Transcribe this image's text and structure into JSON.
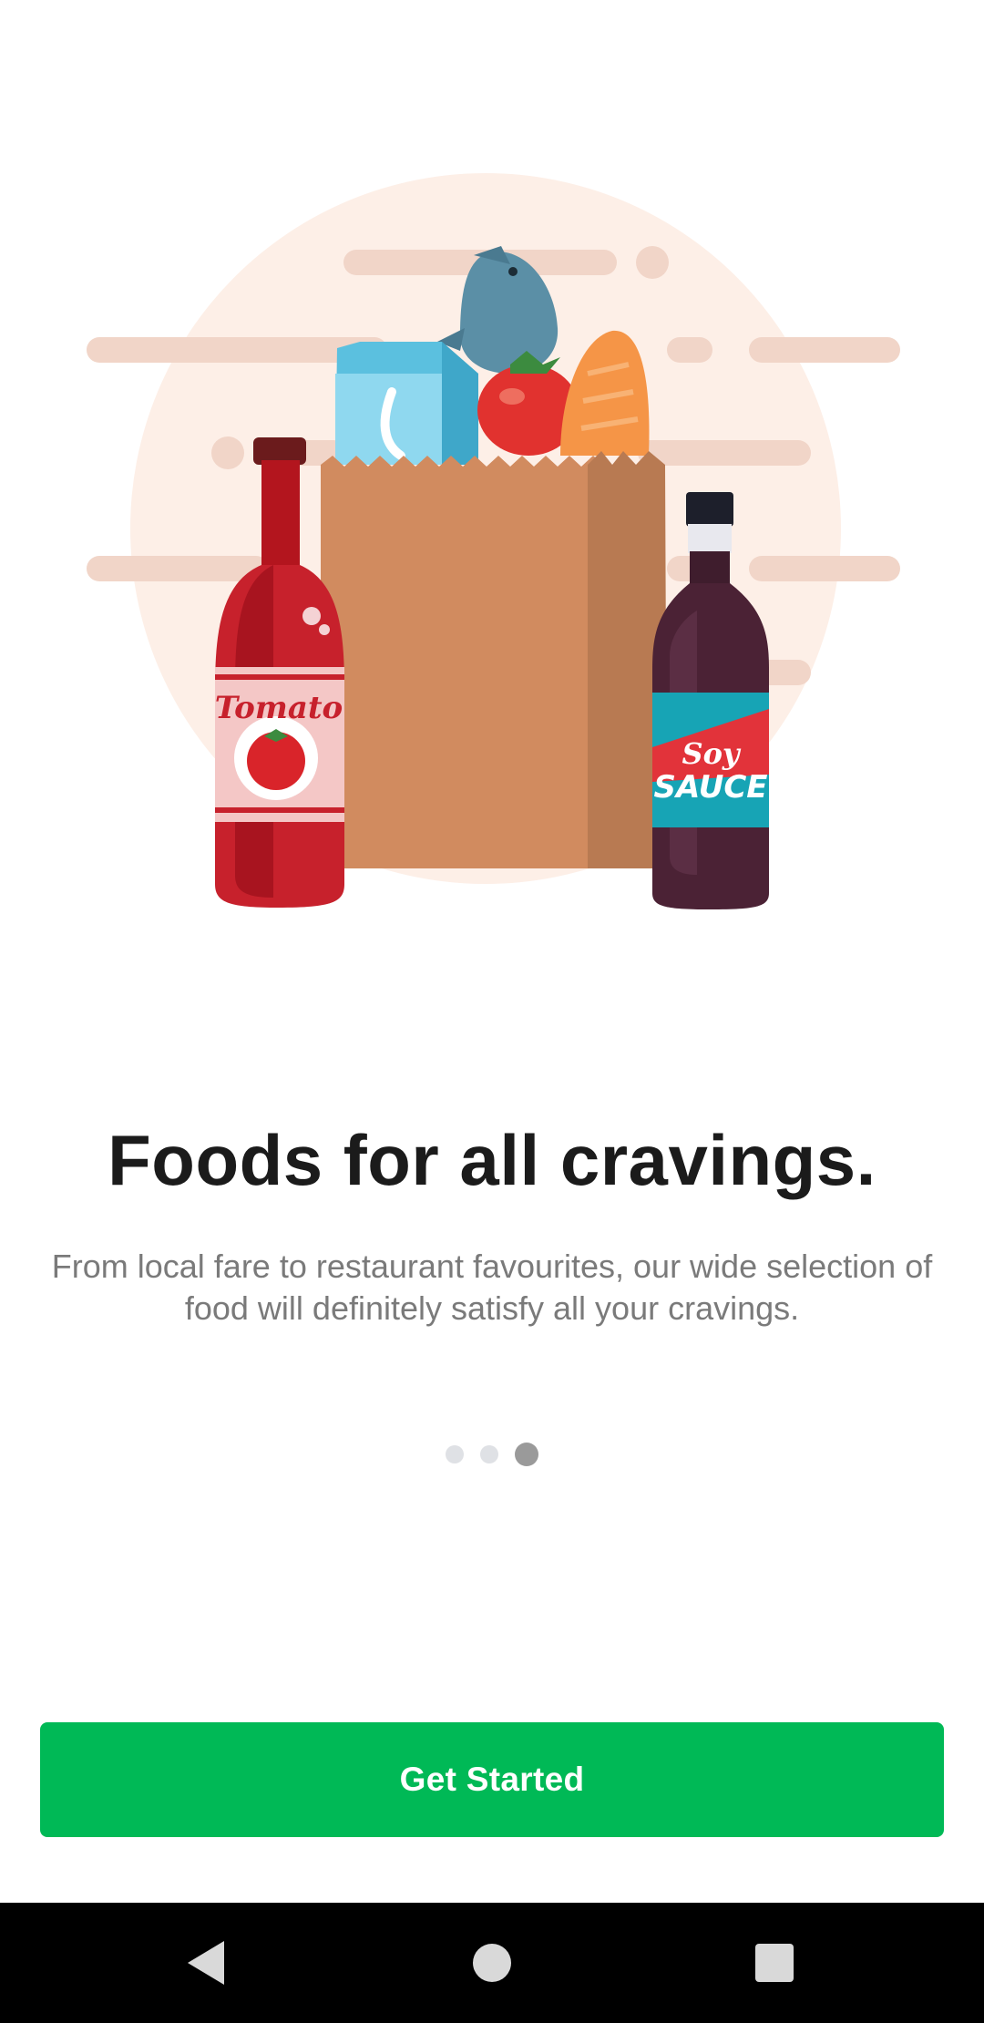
{
  "onboarding": {
    "title": "Foods for all cravings.",
    "subtitle": "From local fare to restaurant favourites, our wide selection of food will definitely satisfy all your cravings.",
    "page_indicator": {
      "total": 3,
      "current": 3
    },
    "cta_label": "Get Started"
  },
  "illustration": {
    "tomato_label": "Tomato",
    "soy_label_top": "Soy",
    "soy_label_bottom": "SAUCE",
    "icons": [
      "grocery-bag-icon",
      "milk-carton-icon",
      "fish-icon",
      "tomato-icon",
      "bread-icon",
      "tomato-sauce-bottle-icon",
      "soy-sauce-bottle-icon"
    ]
  },
  "colors": {
    "accent": "#00b956",
    "title": "#1b1b1b",
    "subtitle": "#7a7a7a",
    "illustration_bg": "#fdefe7"
  },
  "system_nav": {
    "back_icon": "back-triangle-icon",
    "home_icon": "home-circle-icon",
    "recents_icon": "recents-square-icon"
  }
}
